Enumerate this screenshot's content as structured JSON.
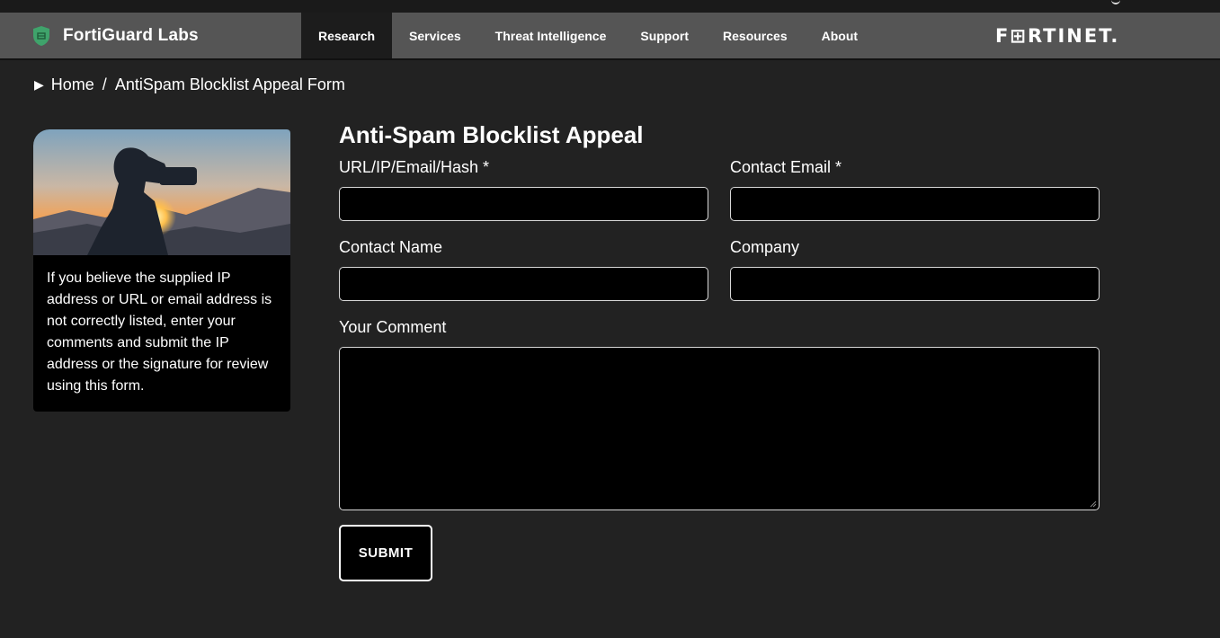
{
  "header": {
    "brand_name": "FortiGuard Labs",
    "logo_text": "F⊞RTINET.",
    "nav": [
      {
        "label": "Research",
        "active": true
      },
      {
        "label": "Services",
        "active": false
      },
      {
        "label": "Threat Intelligence",
        "active": false
      },
      {
        "label": "Support",
        "active": false
      },
      {
        "label": "Resources",
        "active": false
      },
      {
        "label": "About",
        "active": false
      }
    ]
  },
  "breadcrumb": {
    "home": "Home",
    "separator": "/",
    "current": "AntiSpam Blocklist Appeal Form"
  },
  "sidebar_card": {
    "text": "If you believe the supplied IP address or URL or email address is not correctly listed, enter your comments and submit the IP address or the signature for review using this form."
  },
  "form": {
    "title": "Anti-Spam Blocklist Appeal",
    "url_label": "URL/IP/Email/Hash *",
    "url_value": "",
    "email_label": "Contact Email *",
    "email_value": "",
    "name_label": "Contact Name",
    "name_value": "",
    "company_label": "Company",
    "company_value": "",
    "comment_label": "Your Comment",
    "comment_value": "",
    "submit_label": "SUBMIT"
  },
  "colors": {
    "background": "#222222",
    "navbar": "#555555",
    "active_nav": "#1c1c1c",
    "input_background": "#000000",
    "shield_green": "#3fa36b"
  }
}
